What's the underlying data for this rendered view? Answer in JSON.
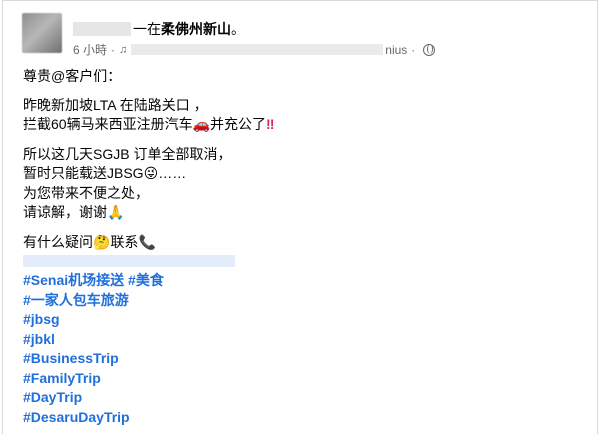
{
  "author": {
    "name_suffix": "一在",
    "location": "柔佛州新山",
    "period": "。"
  },
  "meta": {
    "time": "6 小時",
    "dot": "·",
    "music": "♫",
    "music_tail": "nius",
    "dot2": "·",
    "audience_icon": "globe-icon"
  },
  "post": {
    "greeting": "尊贵@客户们：",
    "p1_l1": "昨晚新加坡LTA 在陆路关口 ，",
    "p1_l2": "拦截60辆马来西亚注册汽车",
    "p1_l2_emoji": "🚗",
    "p1_l2_tail": "并充公了",
    "p1_l2_bang": "‼",
    "p2_l1": "所以这几天SGJB 订单全部取消，",
    "p2_l2": "暂时只能载送JBSG",
    "p2_l2_emoji": "😜",
    "p2_l2_tail": "……",
    "p2_l3": "为您带来不便之处，",
    "p2_l4": "请谅解，谢谢",
    "p2_l4_emoji": "🙏",
    "p3_l1": "有什么疑问",
    "p3_l1_emoji1": "🤔",
    "p3_l1_mid": "联系",
    "p3_l1_emoji2": "📞"
  },
  "hashtags": [
    "#Senai机场接送",
    "#美食",
    "#一家人包车旅游",
    "#jbsg",
    "#jbkl",
    "#BusinessTrip",
    "#FamilyTrip",
    "#DayTrip",
    "#DesaruDayTrip"
  ],
  "colors": {
    "link": "#216fdb",
    "meta_text": "#65676b",
    "text": "#050505"
  }
}
